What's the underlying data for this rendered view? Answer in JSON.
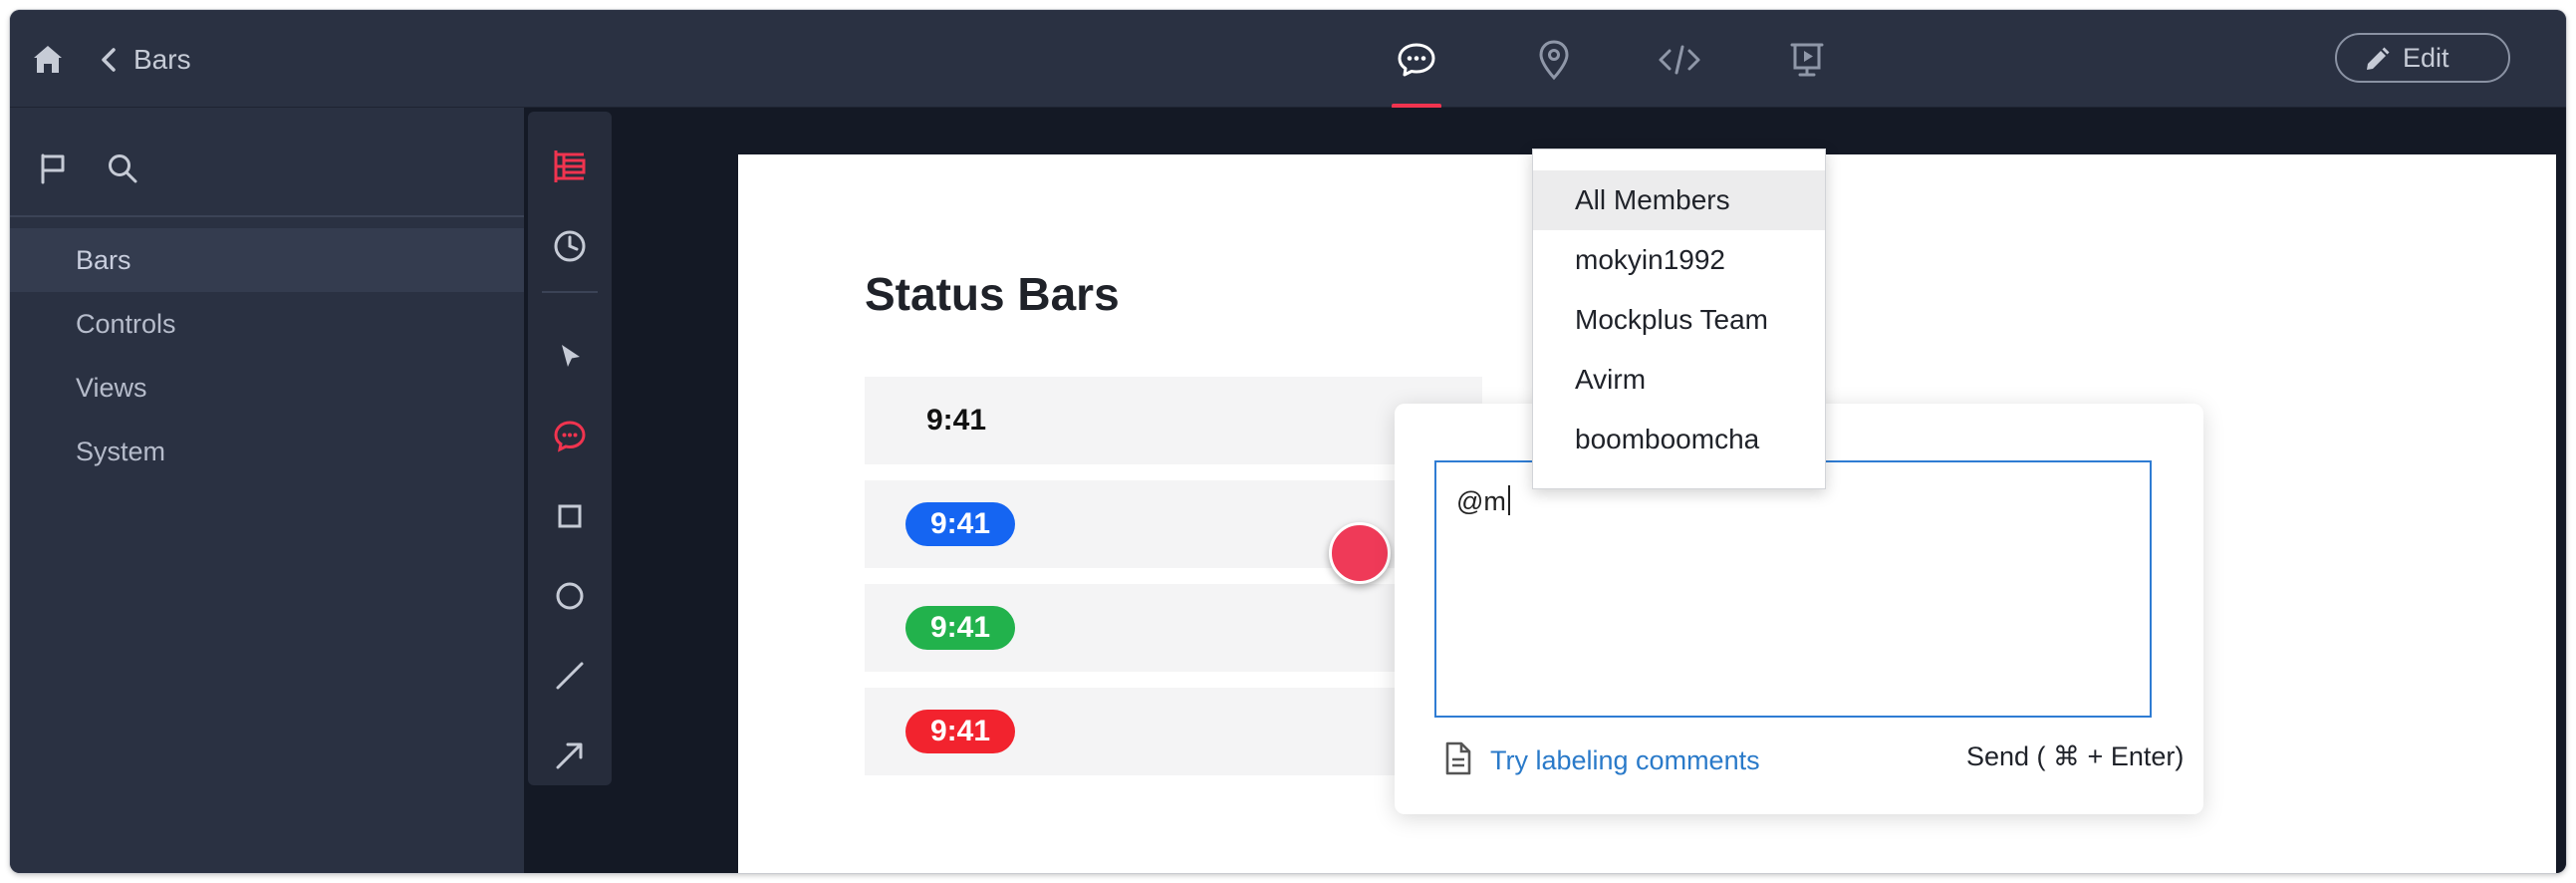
{
  "header": {
    "title": "Bars",
    "home_icon": "home-icon",
    "back_icon": "chevron-left-icon",
    "tabs": [
      {
        "icon": "comment-icon",
        "active": true
      },
      {
        "icon": "location-pin-icon",
        "active": false
      },
      {
        "icon": "code-icon",
        "active": false
      },
      {
        "icon": "presentation-icon",
        "active": false
      }
    ],
    "edit_label": "Edit"
  },
  "sidebar": {
    "items": [
      {
        "label": "Bars",
        "active": true
      },
      {
        "label": "Controls"
      },
      {
        "label": "Views"
      },
      {
        "label": "System"
      }
    ]
  },
  "toolbox": {
    "tools": [
      "layers-icon",
      "history-icon",
      "pointer-icon",
      "comment-icon",
      "rectangle-icon",
      "circle-icon",
      "line-icon",
      "arrow-icon"
    ]
  },
  "artboard": {
    "title": "Status Bars",
    "bars": [
      {
        "time": "9:41",
        "style": "plain"
      },
      {
        "time": "9:41",
        "color": "#1565f2"
      },
      {
        "time": "9:41",
        "color": "#22b24c"
      },
      {
        "time": "9:41",
        "color": "#f2232e"
      }
    ]
  },
  "comment": {
    "input_value": "@m",
    "tip_link": "Try labeling comments",
    "send_label": "Send ( ⌘ + Enter)"
  },
  "mention_dropdown": {
    "options": [
      "All Members",
      "mokyin1992",
      "Mockplus Team",
      "Avirm",
      "boomboomcha"
    ],
    "highlighted": "All Members"
  },
  "colors": {
    "accent": "#f0344f",
    "link": "#2a7ac9",
    "input_border": "#2f7cd3",
    "topbar_bg": "#2a3142",
    "canvas_bg": "#141925"
  }
}
